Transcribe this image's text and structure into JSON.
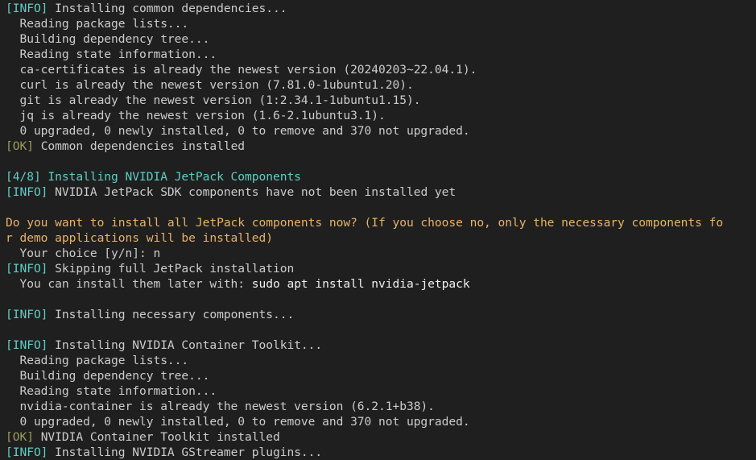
{
  "colors": {
    "background": "#1f1f1f",
    "text": "#cccccc",
    "info": "#5fcec4",
    "ok": "#9b9d5c",
    "prompt": "#e6b36a"
  },
  "lines": [
    [
      {
        "c": "cyan",
        "t": "[INFO]"
      },
      {
        "c": "",
        "t": " Installing common dependencies..."
      }
    ],
    [
      {
        "c": "",
        "t": "  Reading package lists..."
      }
    ],
    [
      {
        "c": "",
        "t": "  Building dependency tree..."
      }
    ],
    [
      {
        "c": "",
        "t": "  Reading state information..."
      }
    ],
    [
      {
        "c": "",
        "t": "  ca-certificates is already the newest version (20240203~22.04.1)."
      }
    ],
    [
      {
        "c": "",
        "t": "  curl is already the newest version (7.81.0-1ubuntu1.20)."
      }
    ],
    [
      {
        "c": "",
        "t": "  git is already the newest version (1:2.34.1-1ubuntu1.15)."
      }
    ],
    [
      {
        "c": "",
        "t": "  jq is already the newest version (1.6-2.1ubuntu3.1)."
      }
    ],
    [
      {
        "c": "",
        "t": "  0 upgraded, 0 newly installed, 0 to remove and 370 not upgraded."
      }
    ],
    [
      {
        "c": "olive",
        "t": "[OK]"
      },
      {
        "c": "",
        "t": " Common dependencies installed"
      }
    ],
    [],
    [
      {
        "c": "cyan",
        "t": "[4/8] Installing NVIDIA JetPack Components"
      }
    ],
    [
      {
        "c": "cyan",
        "t": "[INFO]"
      },
      {
        "c": "",
        "t": " NVIDIA JetPack SDK components have not been installed yet"
      }
    ],
    [],
    [
      {
        "c": "warn",
        "t": "Do you want to install all JetPack components now? (If you choose no, only the necessary components fo"
      }
    ],
    [
      {
        "c": "warn",
        "t": "r demo applications will be installed)"
      }
    ],
    [
      {
        "c": "",
        "t": "  Your choice [y/n]: n"
      }
    ],
    [
      {
        "c": "cyan",
        "t": "[INFO]"
      },
      {
        "c": "",
        "t": " Skipping full JetPack installation"
      }
    ],
    [
      {
        "c": "",
        "t": "  You can install them later with: "
      },
      {
        "c": "bright",
        "t": "sudo apt install nvidia-jetpack"
      }
    ],
    [],
    [
      {
        "c": "cyan",
        "t": "[INFO]"
      },
      {
        "c": "",
        "t": " Installing necessary components..."
      }
    ],
    [],
    [
      {
        "c": "cyan",
        "t": "[INFO]"
      },
      {
        "c": "",
        "t": " Installing NVIDIA Container Toolkit..."
      }
    ],
    [
      {
        "c": "",
        "t": "  Reading package lists..."
      }
    ],
    [
      {
        "c": "",
        "t": "  Building dependency tree..."
      }
    ],
    [
      {
        "c": "",
        "t": "  Reading state information..."
      }
    ],
    [
      {
        "c": "",
        "t": "  nvidia-container is already the newest version (6.2.1+b38)."
      }
    ],
    [
      {
        "c": "",
        "t": "  0 upgraded, 0 newly installed, 0 to remove and 370 not upgraded."
      }
    ],
    [
      {
        "c": "olive",
        "t": "[OK]"
      },
      {
        "c": "",
        "t": " NVIDIA Container Toolkit installed"
      }
    ],
    [
      {
        "c": "cyan",
        "t": "[INFO]"
      },
      {
        "c": "",
        "t": " Installing NVIDIA GStreamer plugins..."
      }
    ]
  ]
}
